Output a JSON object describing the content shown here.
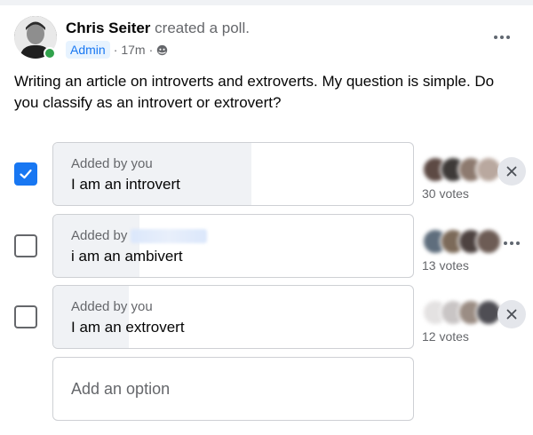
{
  "post": {
    "author": "Chris Seiter",
    "action": "created a poll.",
    "badge": "Admin",
    "time": "17m",
    "separator": "·",
    "audience_icon": "globe-icon",
    "more_icon": "more-horizontal-icon",
    "text": "Writing an article on introverts and extroverts. My question is simple. Do you classify as an introvert or extrovert?"
  },
  "poll": {
    "options": [
      {
        "added_by": "Added by you",
        "label": "I am an introvert",
        "votes": "30 votes",
        "vote_share": 0.55,
        "checked": true,
        "row_action_icon": "close-icon"
      },
      {
        "added_by": "Added by",
        "added_by_name_blurred": true,
        "label": "i am an ambivert",
        "votes": "13 votes",
        "vote_share": 0.24,
        "checked": false,
        "row_action_icon": "more-horizontal-icon"
      },
      {
        "added_by": "Added by you",
        "label": "I am an extrovert",
        "votes": "12 votes",
        "vote_share": 0.21,
        "checked": false,
        "row_action_icon": "close-icon"
      }
    ],
    "add_option_placeholder": "Add an option"
  },
  "colors": {
    "accent": "#1877f2",
    "online": "#31a24c",
    "secondary_text": "#65676b",
    "option_fill": "#f0f2f5",
    "border": "#ced0d4"
  }
}
